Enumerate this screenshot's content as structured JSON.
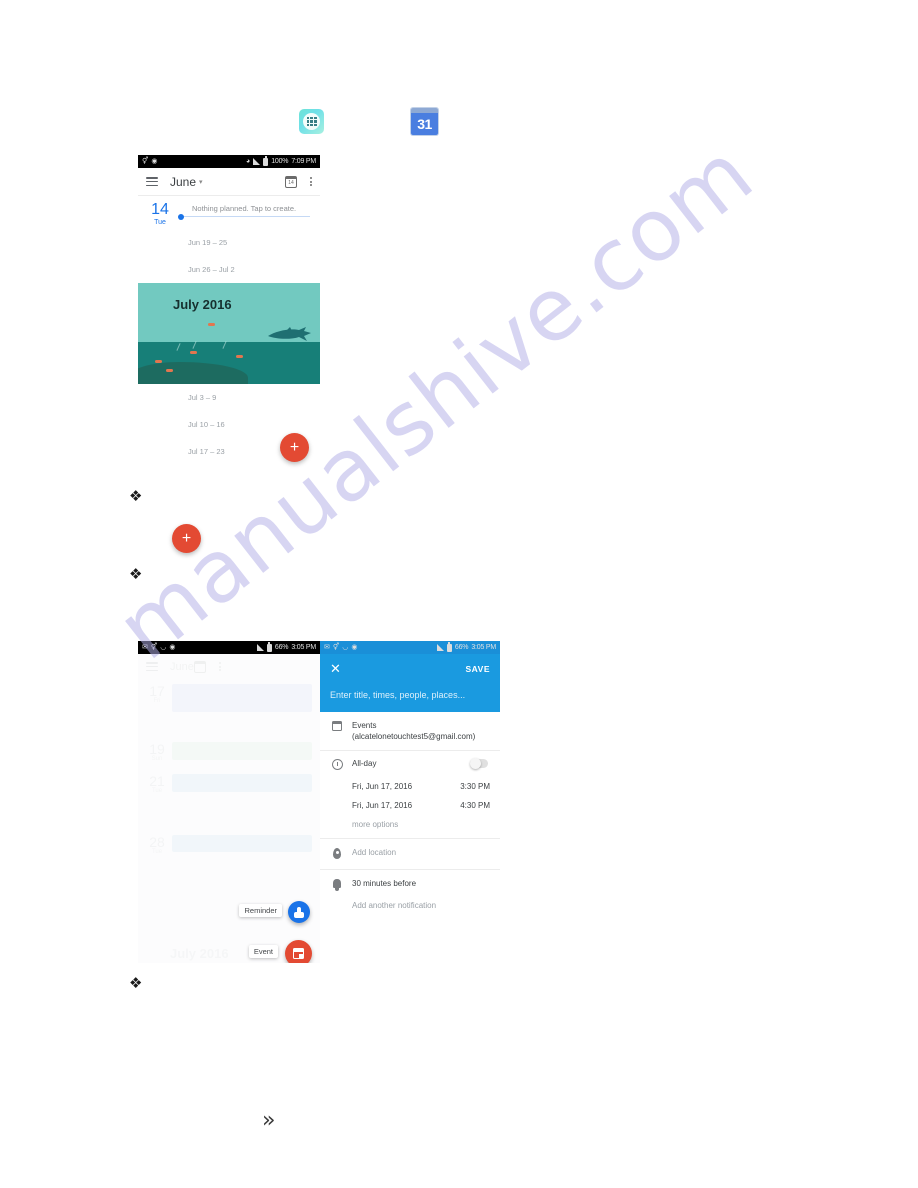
{
  "watermark": {
    "text": "manualshive.com"
  },
  "page": {
    "bullets": [
      "❖",
      "❖",
      "❖"
    ],
    "bottom_chevron": "»"
  },
  "top_icons": {
    "apps_icon_label": "apps-grid",
    "calendar_icon_day": "31"
  },
  "phone1": {
    "status": {
      "battery": "100%",
      "time": "7:09 PM",
      "icons": [
        "usb-icon",
        "message-icon",
        "bluetooth-icon",
        "signal-icon",
        "battery-icon"
      ]
    },
    "appbar": {
      "title": "June",
      "caret": "▾"
    },
    "today": {
      "day_number": "14",
      "day_of_week": "Tue",
      "message": "Nothing planned. Tap to create."
    },
    "weeks_before": [
      "Jun 19 – 25",
      "Jun 26 – Jul 2"
    ],
    "banner_month": "July 2016",
    "weeks_after": [
      "Jul 3 – 9",
      "Jul 10 – 16",
      "Jul 17 – 23"
    ],
    "fab_label": "+"
  },
  "phone2": {
    "status": {
      "battery": "66%",
      "time": "3:05 PM"
    },
    "appbar": {
      "title": "June"
    },
    "rows": [
      {
        "day_number": "17",
        "day_of_week": "Fri"
      },
      {
        "day_number": "19",
        "day_of_week": "Sun"
      },
      {
        "day_number": "21",
        "day_of_week": "Tue"
      },
      {
        "day_number": "28",
        "day_of_week": "Tue"
      }
    ],
    "background_month": "July 2016",
    "speed_dial": {
      "reminder_label": "Reminder",
      "event_label": "Event"
    }
  },
  "phone3": {
    "status": {
      "battery": "66%",
      "time": "3:05 PM"
    },
    "close_label": "✕",
    "save_label": "SAVE",
    "title_placeholder": "Enter title, times, people, places...",
    "account": "Events (alcatelonetouchtest5@gmail.com)",
    "allday_label": "All-day",
    "start_date": "Fri, Jun 17, 2016",
    "start_time": "3:30 PM",
    "end_date": "Fri, Jun 17, 2016",
    "end_time": "4:30 PM",
    "more_options": "more options",
    "location_placeholder": "Add location",
    "notification": "30 minutes before",
    "add_notification": "Add another notification"
  }
}
